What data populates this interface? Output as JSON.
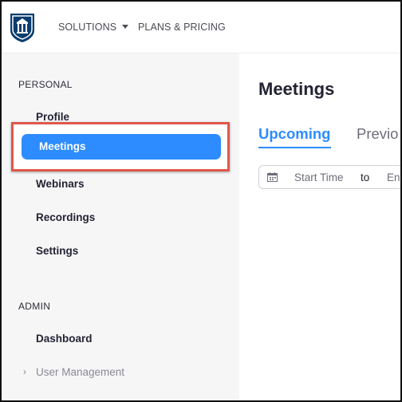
{
  "header": {
    "logo_name": "university-shield-logo",
    "nav": [
      {
        "label": "SOLUTIONS",
        "has_dropdown": true
      },
      {
        "label": "PLANS & PRICING"
      }
    ]
  },
  "sidebar": {
    "personal_title": "PERSONAL",
    "personal_items": [
      "Profile",
      "Meetings",
      "Webinars",
      "Recordings",
      "Settings"
    ],
    "active_item": "Meetings",
    "admin_title": "ADMIN",
    "admin_items": [
      "Dashboard",
      "User Management"
    ]
  },
  "main": {
    "title": "Meetings",
    "tabs": [
      {
        "label": "Upcoming",
        "active": true
      },
      {
        "label": "Previo"
      }
    ],
    "date_filter": {
      "start_placeholder": "Start Time",
      "separator": "to",
      "end_placeholder": "End"
    }
  },
  "colors": {
    "accent": "#2d8cff",
    "highlight_border": "#e0584a",
    "sidebar_bg": "#f6f6f7",
    "text_dark": "#232333"
  }
}
